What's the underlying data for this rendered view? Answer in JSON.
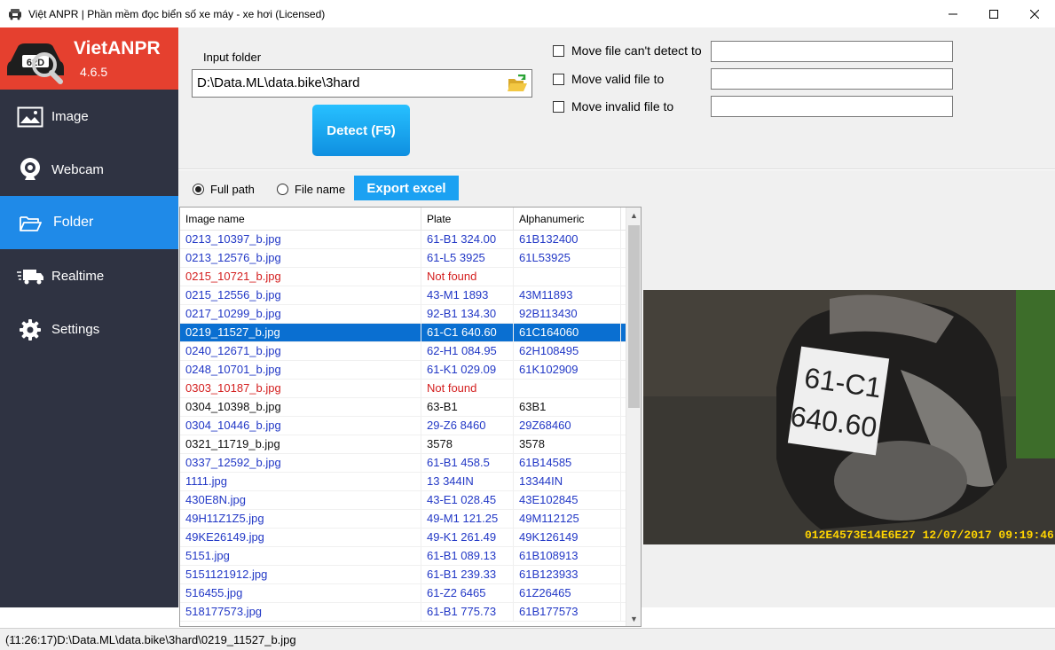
{
  "window": {
    "title": "Việt ANPR | Phần mềm đọc biển số xe máy - xe hơi   (Licensed)"
  },
  "brand": {
    "name": "VietANPR",
    "version": "4.6.5",
    "logo_text": "62D"
  },
  "nav": [
    {
      "label": "Image",
      "icon": "image-icon"
    },
    {
      "label": "Webcam",
      "icon": "webcam-icon"
    },
    {
      "label": "Folder",
      "icon": "folder-icon",
      "active": true
    },
    {
      "label": "Realtime",
      "icon": "truck-icon"
    },
    {
      "label": "Settings",
      "icon": "gear-icon"
    }
  ],
  "input": {
    "label": "Input folder",
    "path": "D:\\Data.ML\\data.bike\\3hard",
    "detect_label": "Detect (F5)"
  },
  "options": [
    {
      "label": "Move file can't detect to",
      "checked": false,
      "value": ""
    },
    {
      "label": "Move valid file to",
      "checked": false,
      "value": ""
    },
    {
      "label": "Move invalid file to",
      "checked": false,
      "value": ""
    }
  ],
  "view": {
    "full_path_label": "Full path",
    "file_name_label": "File name",
    "selected": "Full path",
    "export_label": "Export excel"
  },
  "table": {
    "columns": [
      "Image name",
      "Plate",
      "Alphanumeric"
    ],
    "rows": [
      {
        "name": "0213_10397_b.jpg",
        "plate": "61-B1 324.00",
        "alnum": "61B132400",
        "style": "blue"
      },
      {
        "name": "0213_12576_b.jpg",
        "plate": "61-L5 3925",
        "alnum": "61L53925",
        "style": "blue"
      },
      {
        "name": "0215_10721_b.jpg",
        "plate": "Not found",
        "alnum": "",
        "style": "red"
      },
      {
        "name": "0215_12556_b.jpg",
        "plate": "43-M1 1893",
        "alnum": "43M11893",
        "style": "blue"
      },
      {
        "name": "0217_10299_b.jpg",
        "plate": "92-B1 134.30",
        "alnum": "92B113430",
        "style": "blue"
      },
      {
        "name": "0219_11527_b.jpg",
        "plate": "61-C1 640.60",
        "alnum": "61C164060",
        "style": "sel"
      },
      {
        "name": "0240_12671_b.jpg",
        "plate": "62-H1 084.95",
        "alnum": "62H108495",
        "style": "blue"
      },
      {
        "name": "0248_10701_b.jpg",
        "plate": "61-K1 029.09",
        "alnum": "61K102909",
        "style": "blue"
      },
      {
        "name": "0303_10187_b.jpg",
        "plate": "Not found",
        "alnum": "",
        "style": "red"
      },
      {
        "name": "0304_10398_b.jpg",
        "plate": "63-B1",
        "alnum": "63B1",
        "style": "black"
      },
      {
        "name": "0304_10446_b.jpg",
        "plate": "29-Z6 8460",
        "alnum": "29Z68460",
        "style": "blue"
      },
      {
        "name": "0321_11719_b.jpg",
        "plate": "3578",
        "alnum": "3578",
        "style": "black"
      },
      {
        "name": "0337_12592_b.jpg",
        "plate": "61-B1 458.5",
        "alnum": "61B14585",
        "style": "blue"
      },
      {
        "name": "1111.jpg",
        "plate": "13 344IN",
        "alnum": "13344IN",
        "style": "blue"
      },
      {
        "name": "430E8N.jpg",
        "plate": "43-E1 028.45",
        "alnum": "43E102845",
        "style": "blue"
      },
      {
        "name": "49H11Z1Z5.jpg",
        "plate": "49-M1 121.25",
        "alnum": "49M112125",
        "style": "blue"
      },
      {
        "name": "49KE26149.jpg",
        "plate": "49-K1 261.49",
        "alnum": "49K126149",
        "style": "blue"
      },
      {
        "name": "5151.jpg",
        "plate": "61-B1 089.13",
        "alnum": "61B108913",
        "style": "blue"
      },
      {
        "name": "5151121912.jpg",
        "plate": "61-B1 239.33",
        "alnum": "61B123933",
        "style": "blue"
      },
      {
        "name": "516455.jpg",
        "plate": "61-Z2 6465",
        "alnum": "61Z26465",
        "style": "blue"
      },
      {
        "name": "518177573.jpg",
        "plate": "61-B1 775.73",
        "alnum": "61B177573",
        "style": "blue"
      }
    ]
  },
  "preview": {
    "plate_line1": "61-C1",
    "plate_line2": "640.60",
    "stamp": "012E4573E14E6E27  12/07/2017 09:19:46"
  },
  "status": {
    "text": "(11:26:17)D:\\Data.ML\\data.bike\\3hard\\0219_11527_b.jpg"
  }
}
